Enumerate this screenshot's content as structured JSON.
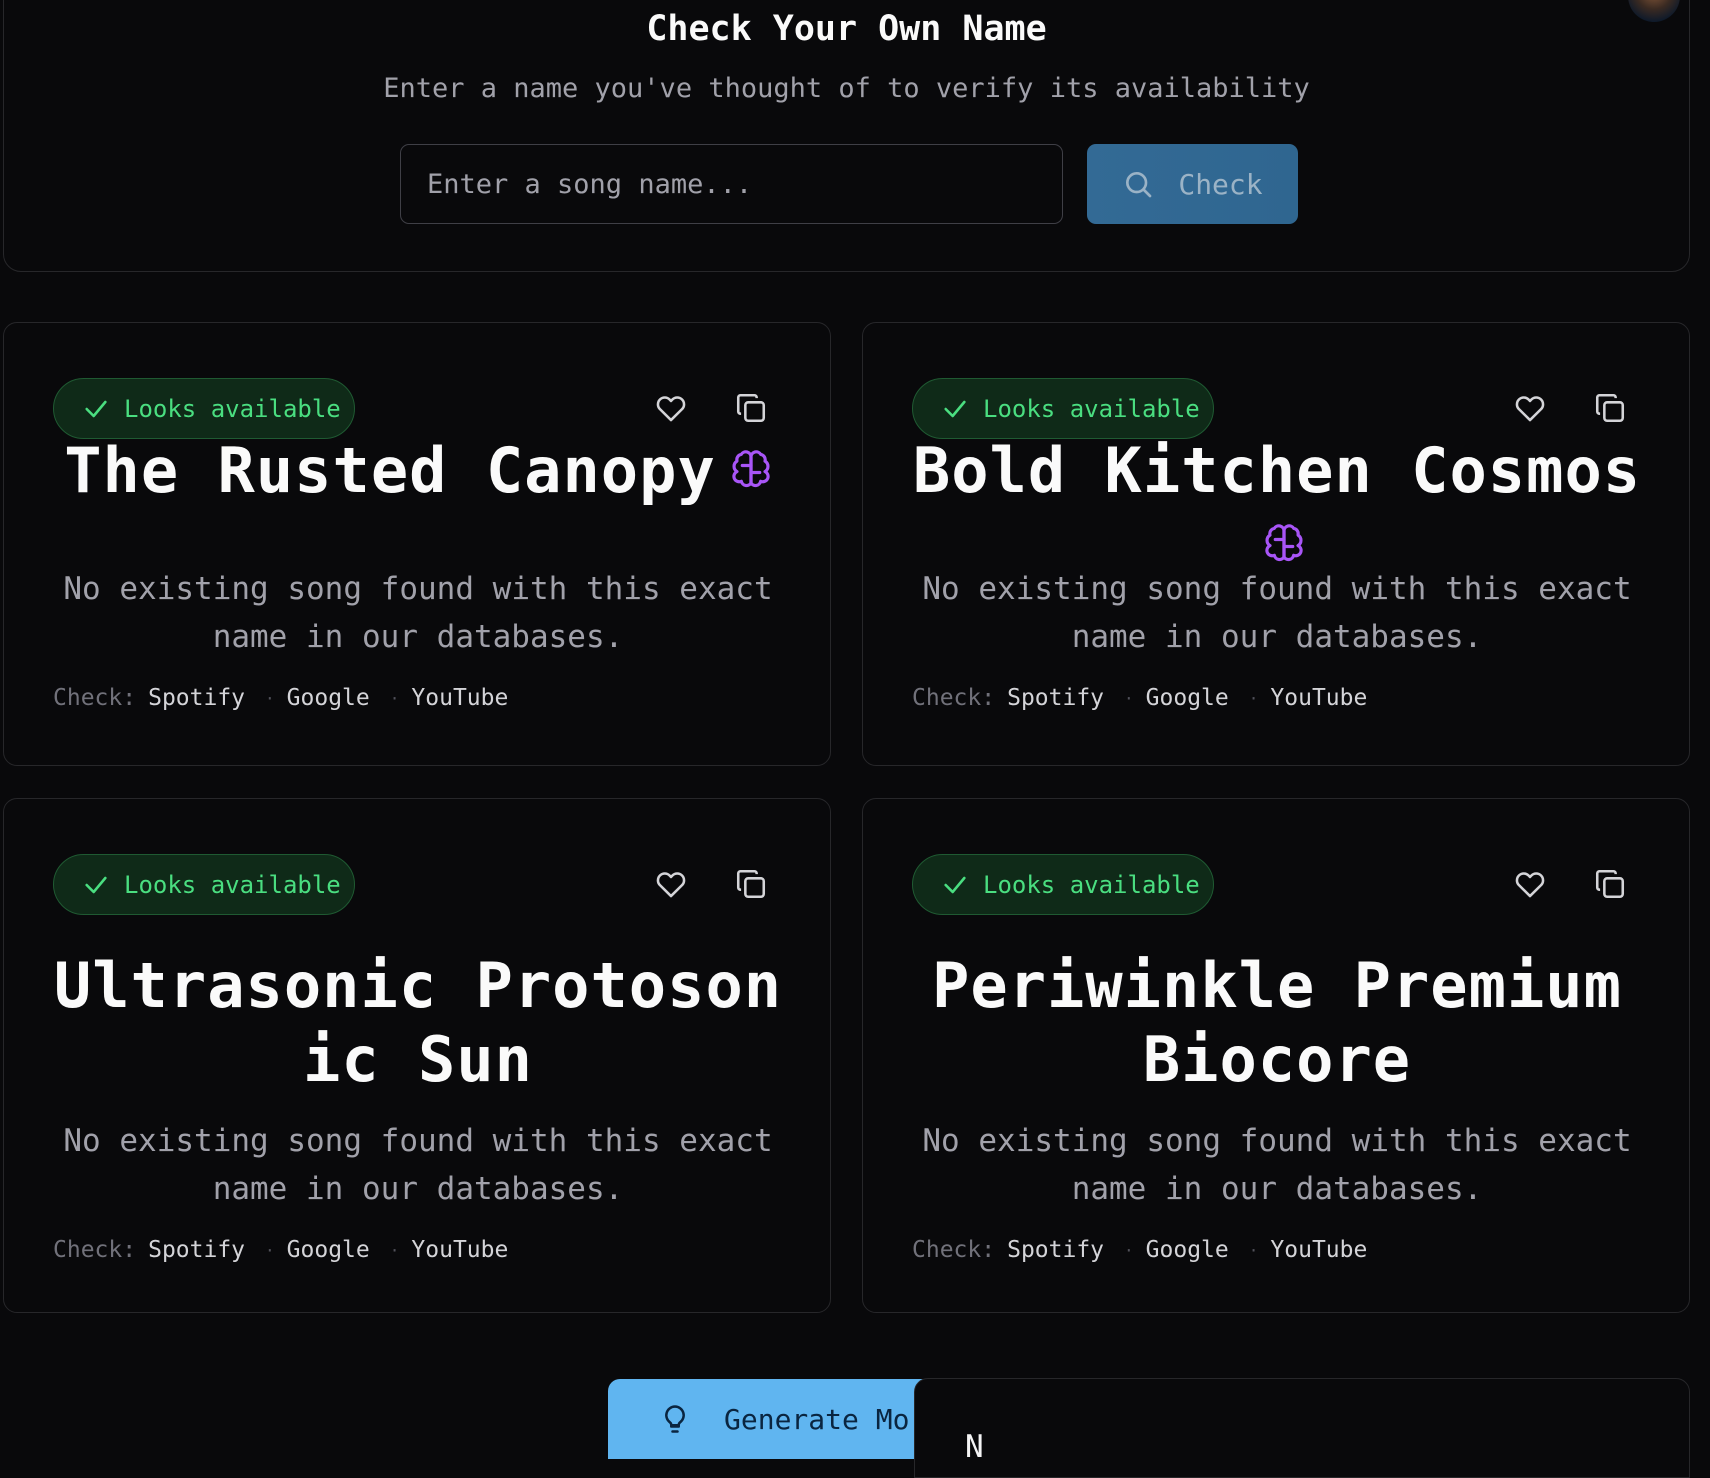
{
  "check_section": {
    "title": "Check Your Own Name",
    "subtitle": "Enter a name you've thought of to verify its availability",
    "input_placeholder": "Enter a song name...",
    "button_label": "Check"
  },
  "cards": [
    {
      "badge": "Looks available",
      "title": "The Rusted Canopy",
      "has_brain_icon": true,
      "description": "No existing song found with this exact name in our databases.",
      "check_label": "Check:",
      "links": [
        "Spotify",
        "Google",
        "YouTube"
      ]
    },
    {
      "badge": "Looks available",
      "title": "Bold Kitchen Cosmos",
      "has_brain_icon": true,
      "description": "No existing song found with this exact name in our databases.",
      "check_label": "Check:",
      "links": [
        "Spotify",
        "Google",
        "YouTube"
      ]
    },
    {
      "badge": "Looks available",
      "title": "Ultrasonic Protosonic Sun",
      "has_brain_icon": false,
      "description": "No existing song found with this exact name in our databases.",
      "check_label": "Check:",
      "links": [
        "Spotify",
        "Google",
        "YouTube"
      ]
    },
    {
      "badge": "Looks available",
      "title": "Periwinkle Premium Biocore",
      "has_brain_icon": false,
      "description": "No existing song found with this exact name in our databases.",
      "check_label": "Check:",
      "links": [
        "Spotify",
        "Google",
        "YouTube"
      ]
    }
  ],
  "generate_button": {
    "label": "Generate Mor"
  },
  "overlay": {
    "text": "N"
  },
  "colors": {
    "background": "#09090b",
    "accent_blue": "#60b5f0",
    "check_button": "#336a95",
    "badge_green": "#4ade80",
    "brain_purple": "#a855f7"
  },
  "icons": {
    "badge": "check-icon",
    "favorite": "heart-icon",
    "copy": "copy-icon",
    "ai": "brain-icon",
    "search": "search-icon",
    "generate": "lightbulb-icon"
  }
}
